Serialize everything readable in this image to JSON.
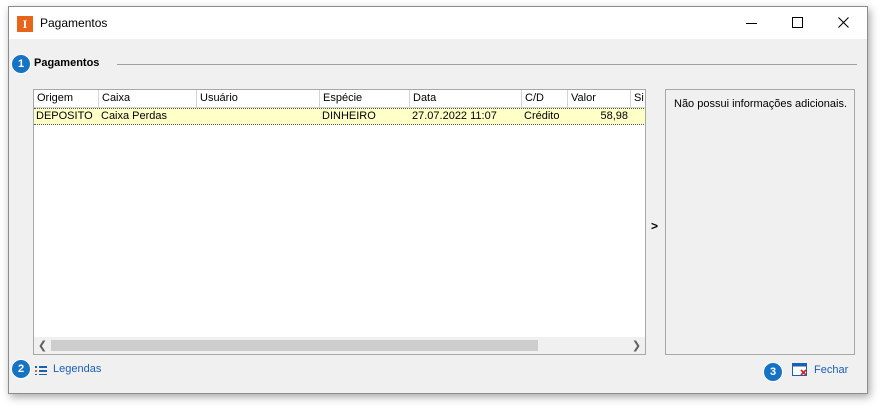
{
  "window": {
    "title": "Pagamentos",
    "app_icon_letter": "I"
  },
  "group": {
    "label": "Pagamentos"
  },
  "badges": [
    "1",
    "2",
    "3"
  ],
  "grid": {
    "columns": [
      "Origem",
      "Caixa",
      "Usuário",
      "Espécie",
      "Data",
      "C/D",
      "Valor",
      "Si"
    ],
    "rows": [
      {
        "origem": "DEPOSITO",
        "caixa": "Caixa  Perdas",
        "usuario": "",
        "especie": "DINHEIRO",
        "data": "27.07.2022 11:07",
        "cd": "Crédito",
        "valor": "58,98"
      }
    ]
  },
  "expander": ">",
  "info": {
    "text": "Não possui informações adicionais."
  },
  "footer": {
    "legend_label": "Legendas",
    "close_label": "Fechar"
  },
  "colors": {
    "accent": "#1673c3",
    "selected_row": "#ffffc8",
    "link": "#1a5fb4",
    "app_icon": "#e8641b"
  }
}
